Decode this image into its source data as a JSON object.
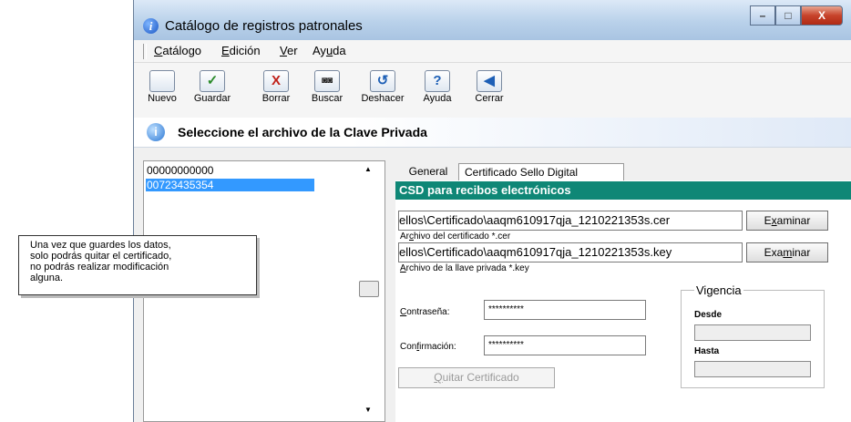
{
  "window": {
    "title": "Catálogo de registros patronales",
    "app_icon": "i",
    "buttons": [
      "–",
      "□",
      "X"
    ]
  },
  "menu": [
    {
      "pre": "",
      "key": "C",
      "post": "atálogo"
    },
    {
      "pre": "",
      "key": "E",
      "post": "dición"
    },
    {
      "pre": "",
      "key": "V",
      "post": "er"
    },
    {
      "pre": "Ay",
      "key": "u",
      "post": "da"
    }
  ],
  "toolbar": [
    {
      "label": "Nuevo",
      "icon": "new-document-icon",
      "glyph": "",
      "color": "#5a7bb0"
    },
    {
      "label": "Guardar",
      "icon": "checkmark-icon",
      "glyph": "✓",
      "color": "#2a8a2a"
    },
    {
      "label": "Borrar",
      "icon": "delete-x-icon",
      "glyph": "X",
      "color": "#c0211a"
    },
    {
      "label": "Buscar",
      "icon": "binoculars-icon",
      "glyph": "◙◙",
      "color": "#222222"
    },
    {
      "label": "Deshacer",
      "icon": "undo-icon",
      "glyph": "↺",
      "color": "#1d5fb6"
    },
    {
      "label": "Ayuda",
      "icon": "help-icon",
      "glyph": "?",
      "color": "#1d5fb6"
    },
    {
      "label": "Cerrar",
      "icon": "exit-door-icon",
      "glyph": "◀",
      "color": "#1d5fb6"
    }
  ],
  "info_bar": {
    "icon": "info-icon",
    "text": "Seleccione el archivo de la Clave Privada"
  },
  "list": {
    "items": [
      "00000000000",
      "00723435354"
    ],
    "selected_index": 1
  },
  "tabs": [
    {
      "label": "General"
    },
    {
      "label": "Certificado Sello Digital",
      "active": true
    }
  ],
  "section_header": "CSD para recibos electrónicos",
  "cert": {
    "cer_path": "ellos\\Certificado\\aaqm610917qja_1210221353s.cer",
    "cer_label_pre": "Ar",
    "cer_label_key": "c",
    "cer_label_post": "hivo del certificado *.cer",
    "key_path": "ellos\\Certificado\\aaqm610917qja_1210221353s.key",
    "key_label_pre": "",
    "key_label_key": "A",
    "key_label_post": "rchivo de la llave privada *.key",
    "browse1": {
      "pre": "E",
      "key": "x",
      "post": "aminar"
    },
    "browse2": {
      "pre": "Exa",
      "key": "m",
      "post": "inar"
    }
  },
  "password": {
    "label_pre": "",
    "label_key": "C",
    "label_post": "ontraseña:",
    "value": "**********"
  },
  "confirm": {
    "label_pre": "Con",
    "label_key": "f",
    "label_post": "irmación:",
    "value": "**********"
  },
  "remove_button": {
    "pre": "",
    "key": "Q",
    "post": "uitar Certificado"
  },
  "vigencia": {
    "title": "Vigencia",
    "desde": "Desde",
    "hasta": "Hasta"
  },
  "tooltip": [
    "Una vez que guardes los datos,",
    "solo podrás quitar el certificado,",
    "no podrás realizar modificación",
    "alguna."
  ]
}
